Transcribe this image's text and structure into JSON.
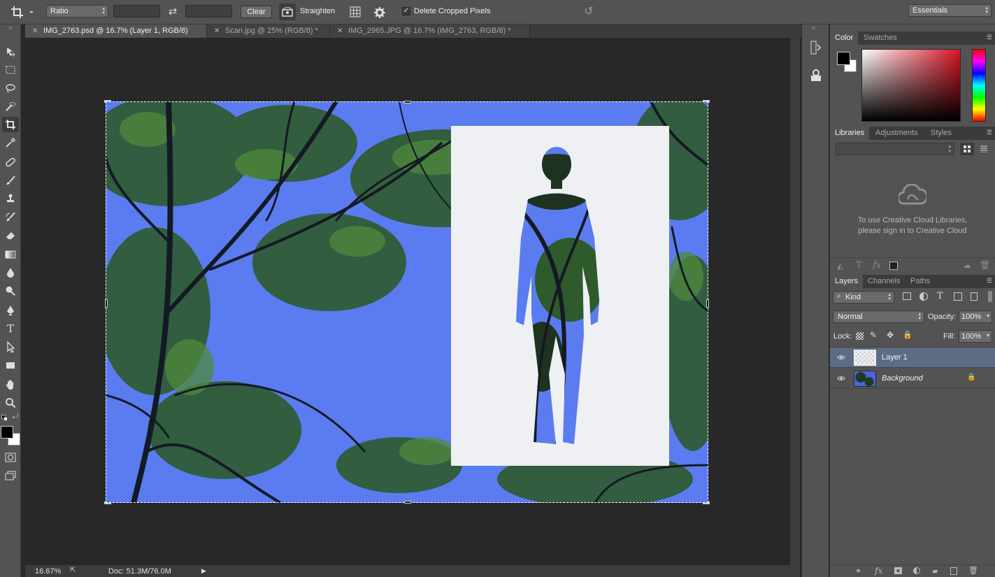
{
  "options_bar": {
    "ratio_select": "Ratio",
    "clear_button": "Clear",
    "straighten_label": "Straighten",
    "delete_cropped_label": "Delete Cropped Pixels",
    "delete_cropped_checked": true,
    "workspace_select": "Essentials"
  },
  "tabs": [
    {
      "label": "IMG_2763.psd @ 16.7% (Layer 1, RGB/8)",
      "active": true
    },
    {
      "label": "Scan.jpg @ 25% (RGB/8) *",
      "active": false
    },
    {
      "label": "IMG_2965.JPG @ 16.7% (IMG_2763, RGB/8) *",
      "active": false
    }
  ],
  "tools": [
    "move-icon",
    "marquee-icon",
    "lasso-icon",
    "quick-select-icon",
    "crop-icon",
    "eyedropper-icon",
    "healing-icon",
    "brush-icon",
    "stamp-icon",
    "history-brush-icon",
    "eraser-icon",
    "gradient-icon",
    "blur-icon",
    "dodge-icon",
    "pen-icon",
    "type-icon",
    "path-select-icon",
    "rectangle-icon",
    "hand-icon",
    "zoom-icon"
  ],
  "status": {
    "zoom": "16.67%",
    "doc": "Doc: 51.3M/76.0M"
  },
  "color_panel": {
    "tabs": [
      "Color",
      "Swatches"
    ],
    "foreground": "#000000",
    "background": "#ffffff",
    "hue_color": "#d81424"
  },
  "libraries_panel": {
    "tabs": [
      "Libraries",
      "Adjustments",
      "Styles"
    ],
    "message_line1": "To use Creative Cloud Libraries,",
    "message_line2": "please sign in to Creative Cloud"
  },
  "layers_panel": {
    "tabs": [
      "Layers",
      "Channels",
      "Paths"
    ],
    "filter_kind": "Kind",
    "blend_mode": "Normal",
    "opacity_label": "Opacity:",
    "opacity": "100%",
    "lock_label": "Lock:",
    "fill_label": "Fill:",
    "fill": "100%",
    "layers": [
      {
        "name": "Layer 1",
        "selected": true,
        "locked": false
      },
      {
        "name": "Background",
        "selected": false,
        "locked": true
      }
    ]
  },
  "colors": {
    "sky_blue": "#5a7cf0",
    "selection_blue": "#5c6c86",
    "ui_gray": "#535353"
  }
}
